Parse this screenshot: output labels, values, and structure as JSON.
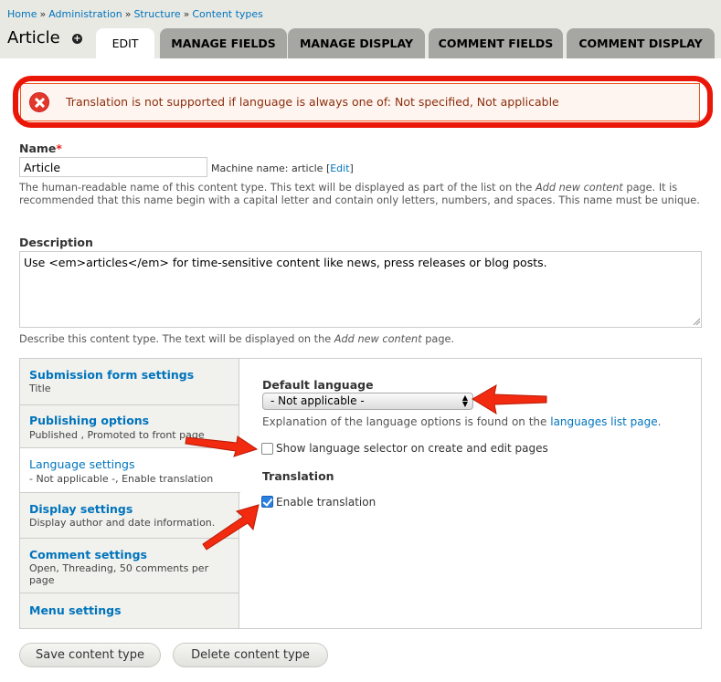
{
  "breadcrumb": {
    "items": [
      "Home",
      "Administration",
      "Structure",
      "Content types"
    ],
    "separator": "»"
  },
  "header": {
    "title": "Article",
    "shortcut_symbol": "+",
    "tabs": [
      {
        "label": "EDIT",
        "active": true
      },
      {
        "label": "MANAGE FIELDS",
        "active": false
      },
      {
        "label": "MANAGE DISPLAY",
        "active": false
      },
      {
        "label": "COMMENT FIELDS",
        "active": false
      },
      {
        "label": "COMMENT DISPLAY",
        "active": false
      }
    ]
  },
  "error": {
    "message": "Translation is not supported if language is always one of: Not specified, Not applicable"
  },
  "form": {
    "name": {
      "label": "Name",
      "required_marker": "*",
      "value": "Article",
      "machine_name_prefix": "Machine name: article [",
      "machine_name_link": "Edit",
      "machine_name_suffix": "]",
      "description": "The human-readable name of this content type. This text will be displayed as part of the list on the",
      "description_em": "Add new content",
      "description_rest": "page. It is recommended that this name begin with a capital letter and contain only letters, numbers, and spaces. This name must be unique."
    },
    "description": {
      "label": "Description",
      "value": "Use <em>articles</em> for time-sensitive content like news, press releases or blog posts.",
      "help_prefix": "Describe this content type. The text will be displayed on the",
      "help_em": "Add new content",
      "help_suffix": "page."
    }
  },
  "vertical_tabs": [
    {
      "title": "Submission form settings",
      "summary": "Title",
      "active": false
    },
    {
      "title": "Publishing options",
      "summary": "Published , Promoted to front page",
      "active": false
    },
    {
      "title": "Language settings",
      "summary": "- Not applicable -, Enable translation",
      "active": true
    },
    {
      "title": "Display settings",
      "summary": "Display author and date information.",
      "active": false
    },
    {
      "title": "Comment settings",
      "summary": "Open, Threading, 50 comments per page",
      "active": false
    },
    {
      "title": "Menu settings",
      "summary": "",
      "active": false
    }
  ],
  "language_pane": {
    "default_language_label": "Default language",
    "default_language_value": "- Not applicable -",
    "help_prefix": "Explanation of the language options is found on the",
    "help_link": "languages list page",
    "help_suffix": ".",
    "show_selector_label": "Show language selector on create and edit pages",
    "show_selector_checked": false,
    "translation_heading": "Translation",
    "enable_translation_label": "Enable translation",
    "enable_translation_checked": true
  },
  "actions": {
    "save_label": "Save content type",
    "delete_label": "Delete content type"
  },
  "colors": {
    "link": "#0074bd",
    "error_border": "#ea1608",
    "arrow": "#f22a10",
    "tab_inactive": "#a6a7a2"
  }
}
